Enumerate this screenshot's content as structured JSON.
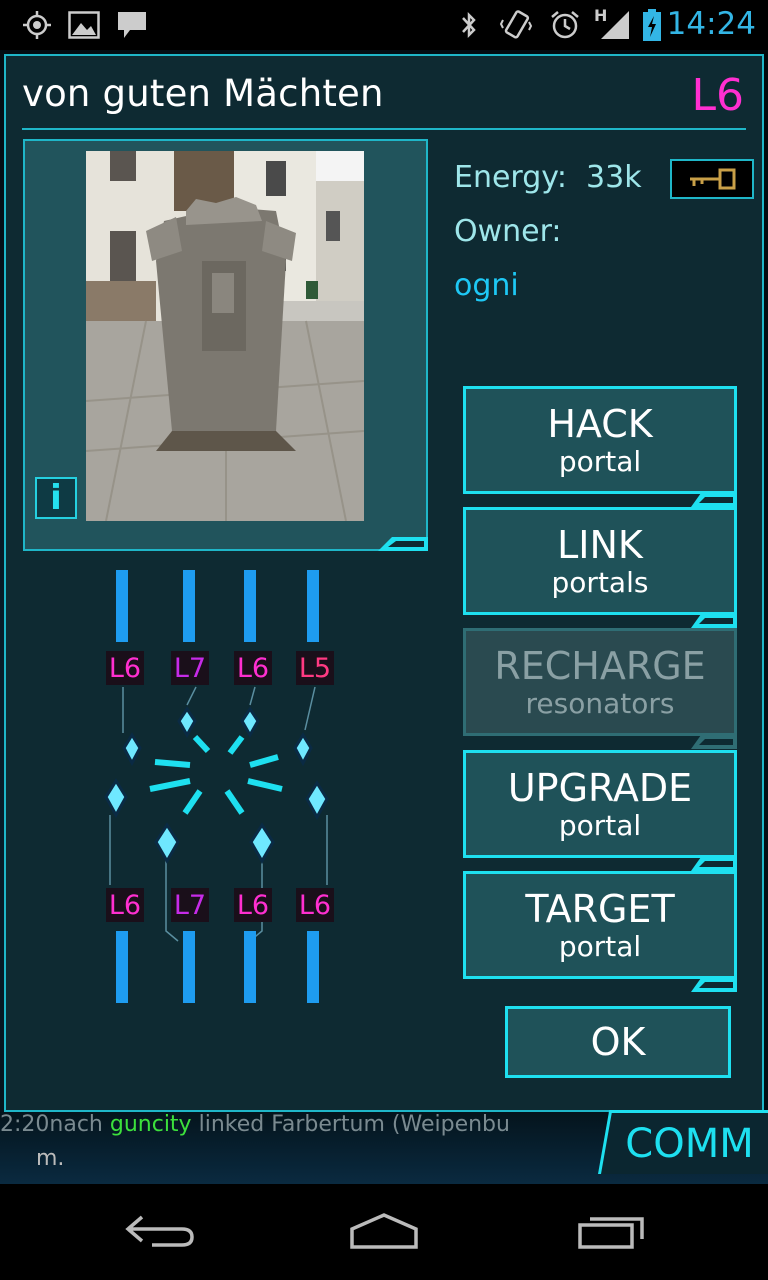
{
  "status_bar": {
    "time": "14:24",
    "icons": [
      "gps-icon",
      "picture-icon",
      "chat-icon",
      "bluetooth-icon",
      "vibrate-icon",
      "alarm-icon",
      "signal-h-icon",
      "battery-charging-icon"
    ],
    "signal_label": "H"
  },
  "portal": {
    "title": "von guten Mächten",
    "level": "L6",
    "energy_label": "Energy:",
    "energy_value": "33k",
    "owner_label": "Owner:",
    "owner_name": "ogni",
    "info_label": "i",
    "key_icon": "key-icon"
  },
  "actions": [
    {
      "big": "HACK",
      "small": "portal",
      "enabled": true
    },
    {
      "big": "LINK",
      "small": "portals",
      "enabled": true
    },
    {
      "big": "RECHARGE",
      "small": "resonators",
      "enabled": false
    },
    {
      "big": "UPGRADE",
      "small": "portal",
      "enabled": true
    },
    {
      "big": "TARGET",
      "small": "portal",
      "enabled": true
    }
  ],
  "ok_label": "OK",
  "resonators": {
    "top": [
      {
        "level": "L6",
        "color": "#ff2fd0"
      },
      {
        "level": "L7",
        "color": "#c72be8"
      },
      {
        "level": "L6",
        "color": "#ff2fd0"
      },
      {
        "level": "L5",
        "color": "#ff3a82"
      }
    ],
    "bottom": [
      {
        "level": "L6",
        "color": "#ff2fd0"
      },
      {
        "level": "L7",
        "color": "#c72be8"
      },
      {
        "level": "L6",
        "color": "#ff2fd0"
      },
      {
        "level": "L6",
        "color": "#ff2fd0"
      }
    ]
  },
  "comm": {
    "label": "COMM",
    "line1_prefix": "2:20nach",
    "line1_agent": "guncity",
    "line1_rest": "linked Farbertum (Weipenbu",
    "line2": "m."
  },
  "colors": {
    "accent": "#1ee0f0",
    "magenta": "#ff2fd0",
    "owner": "#1ec8f5"
  }
}
